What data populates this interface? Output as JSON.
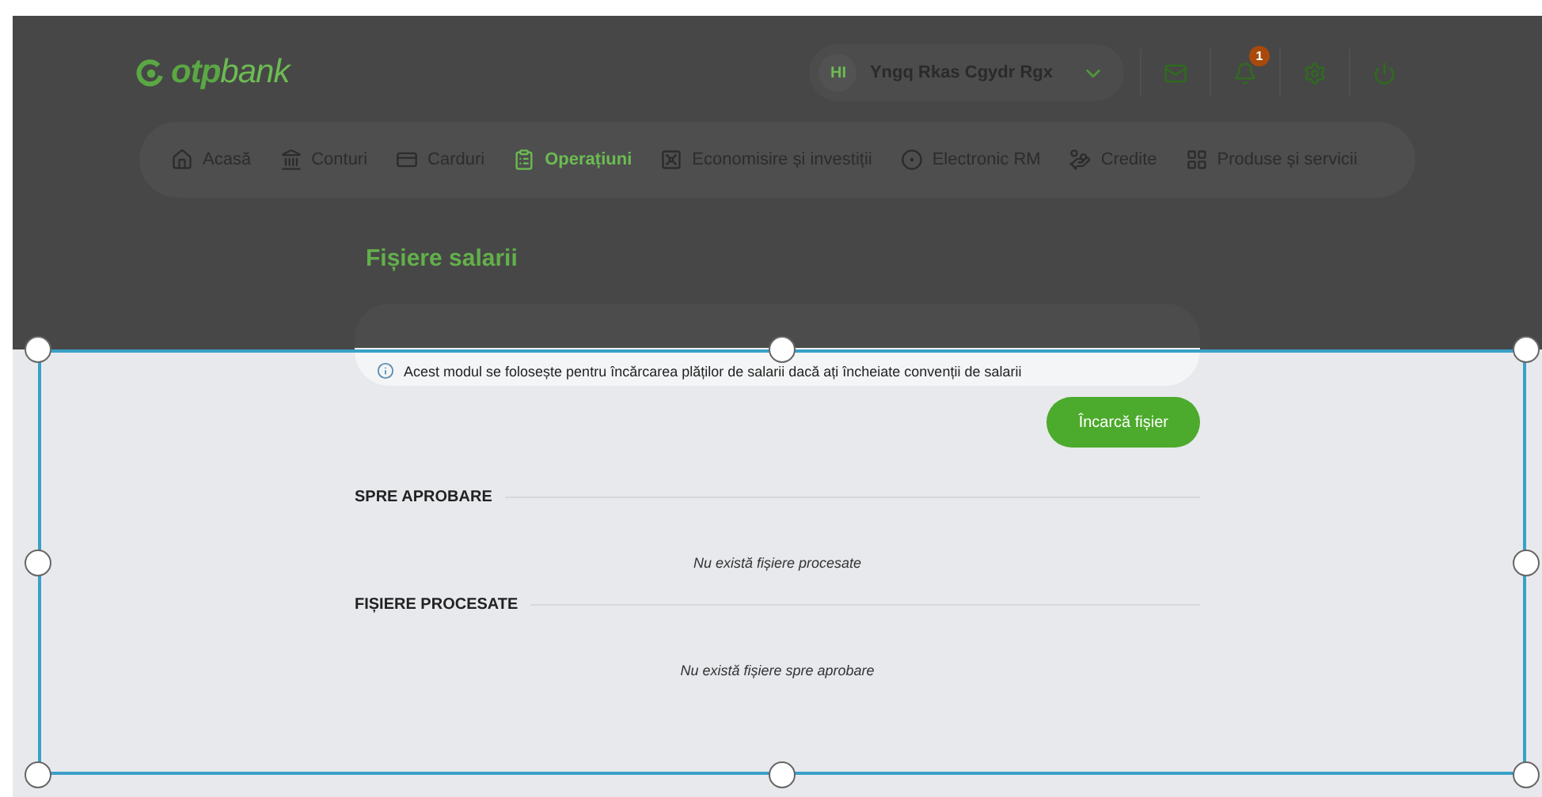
{
  "header": {
    "logo": {
      "brand": "otp",
      "suffix": "bank"
    },
    "user": {
      "initials": "HI",
      "name": "Yngq Rkas Cgydr Rgx"
    },
    "notifications": {
      "count": "1"
    }
  },
  "nav": [
    {
      "label": "Acasă",
      "selected": false
    },
    {
      "label": "Conturi",
      "selected": false
    },
    {
      "label": "Carduri",
      "selected": false
    },
    {
      "label": "Operațiuni",
      "selected": true
    },
    {
      "label": "Economisire și investiții",
      "selected": false
    },
    {
      "label": "Electronic RM",
      "selected": false
    },
    {
      "label": "Credite",
      "selected": false
    },
    {
      "label": "Produse și servicii",
      "selected": false
    }
  ],
  "page": {
    "title": "Fișiere salarii",
    "info": "Acest modul se folosește pentru încărcarea plăților de salarii dacă ați încheiate convenții de salarii",
    "upload_button": "Încarcă fișier",
    "sections": [
      {
        "heading": "SPRE APROBARE",
        "empty": "Nu există fișiere procesate"
      },
      {
        "heading": "FIȘIERE PROCESATE",
        "empty": "Nu există fișiere spre aprobare"
      }
    ]
  }
}
